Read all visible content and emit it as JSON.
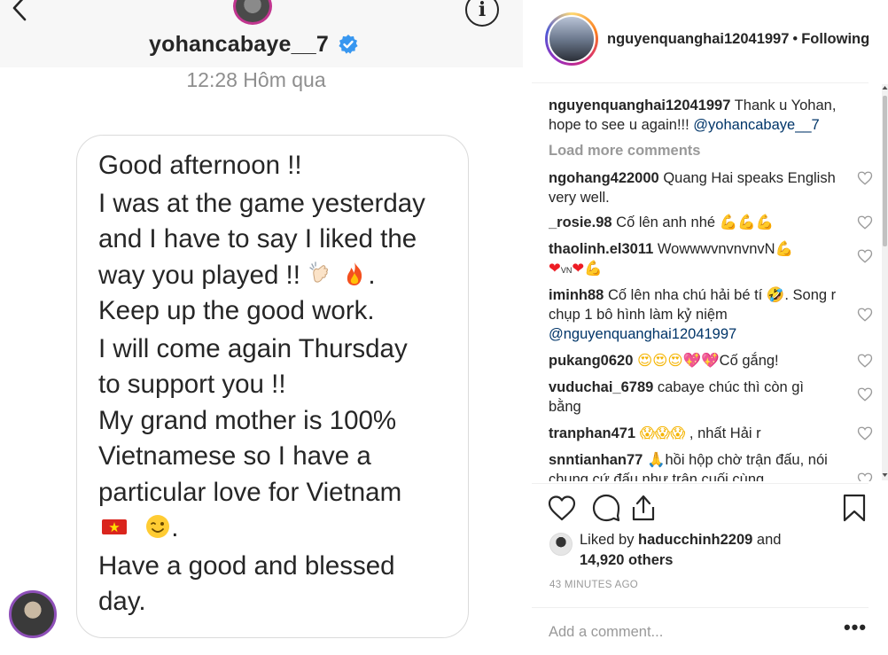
{
  "dm": {
    "username": "yohancabaye__7",
    "timestamp": "12:28 Hôm qua",
    "message_lines": [
      "Good afternoon !!",
      "I was at the game yesterday",
      "and I have to say I liked the",
      "way you played !!",
      ".",
      "Keep up the good work.",
      "I will come again Thursday",
      "to support you !!",
      "My grand mother is 100%",
      "Vietnamese so I have a",
      "particular love for Vietnam",
      ".",
      "Have a good and blessed",
      "day."
    ],
    "icons": {
      "back": "back-arrow-icon",
      "info": "info-icon",
      "verified": "verified-badge-icon"
    },
    "info_glyph": "i"
  },
  "post": {
    "header": {
      "username": "nguyenquanghai12041997",
      "separator": "•",
      "follow_status": "Following"
    },
    "caption": {
      "user": "nguyenquanghai12041997",
      "text": "Thank u Yohan, hope to see u again!!! ",
      "mention": "@yohancabaye__7"
    },
    "load_more": "Load more comments",
    "comments": [
      {
        "user": "ngohang422000",
        "text": "Quang Hai speaks English very well."
      },
      {
        "user": "_rosie.98",
        "text": "Cố lên anh nhé "
      },
      {
        "user": "thaolinh.el3011",
        "text": "WowwwvnvnvnvN"
      },
      {
        "user": "iminh88",
        "text": "Cố lên nha chú hải bé tí ",
        "text2": ". Song r chụp 1 bô hình làm kỷ niệm ",
        "mention": "@nguyenquanghai12041997"
      },
      {
        "user": "pukang0620",
        "text": "Cố gắng!"
      },
      {
        "user": "vuduchai_6789",
        "text": "cabaye chúc thì còn gì bằng"
      },
      {
        "user": "tranphan471",
        "text": " , nhất Hải r"
      },
      {
        "user": "snntianhan77",
        "text": "hồi hộp chờ trận đấu, nói chung cứ đấu như trận cuối cùng"
      }
    ],
    "vn_label": "VN",
    "likes": {
      "prefix": "Liked by ",
      "user": "haducchinh2209",
      "middle": " and",
      "count": "14,920 others"
    },
    "time_ago": "43 MINUTES AGO",
    "comment_placeholder": "Add a comment...",
    "more_options": "•••"
  },
  "colors": {
    "accent_link": "#003569",
    "verified_blue": "#3897f0",
    "muted": "#999999",
    "heart_red": "#ed1c24",
    "flex_yellow": "#f5b400"
  }
}
